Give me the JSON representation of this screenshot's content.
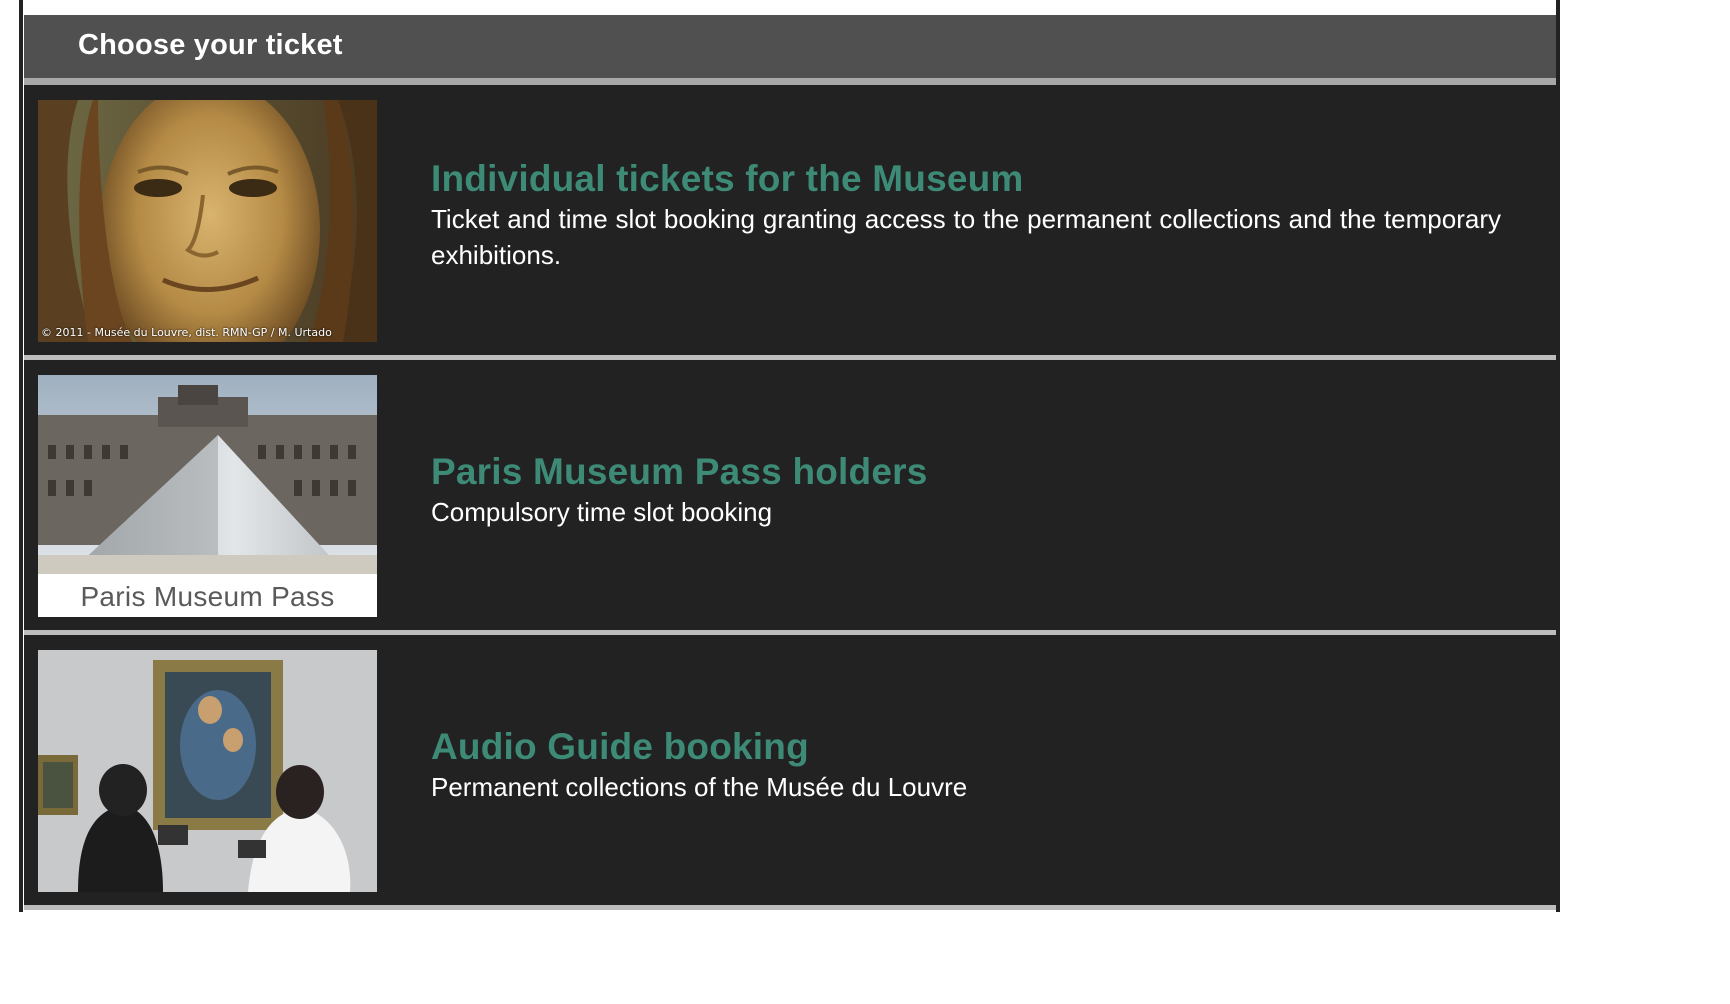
{
  "header": {
    "title": "Choose your ticket"
  },
  "tickets": [
    {
      "title": "Individual tickets for the Museum",
      "description": "Ticket and time slot booking granting access to the permanent collections and the temporary exhibitions.",
      "image_credit": "© 2011 - Musée du Louvre, dist. RMN-GP / M. Urtado",
      "image": "mona-lisa-image"
    },
    {
      "title": "Paris Museum Pass holders",
      "description": "Compulsory time slot booking",
      "image_caption": "Paris Museum Pass",
      "image": "louvre-pyramid-image"
    },
    {
      "title": "Audio Guide booking",
      "description": "Permanent collections of the Musée du Louvre",
      "image": "audio-guide-visitors-image"
    }
  ],
  "colors": {
    "header_bg": "#505050",
    "row_bg": "#222222",
    "title_accent": "#3d8b77",
    "divider": "#bdbdbd"
  }
}
